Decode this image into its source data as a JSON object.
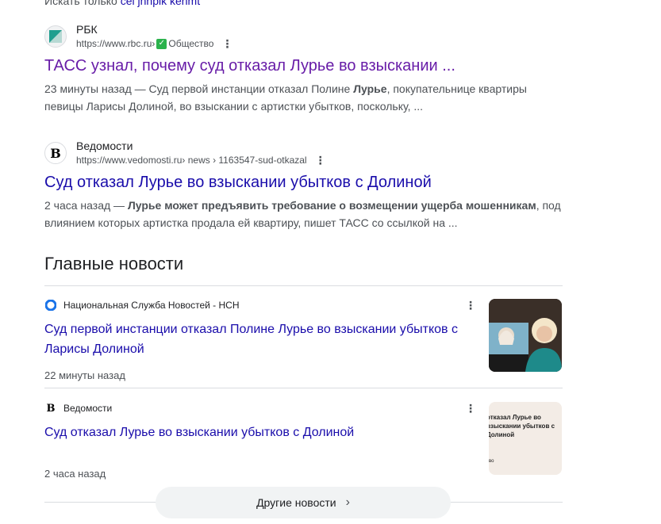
{
  "top": {
    "prefix": "Искать только ",
    "link": "cei jhnpik kehmt"
  },
  "results": [
    {
      "source": "РБК",
      "url": "https://www.rbc.ru",
      "url_sep": " › ",
      "url_tail": "Общество",
      "title": "ТАСС узнал, почему суд отказал Лурье во взыскании ...",
      "snippet_pre": "23 минуты назад — Суд первой инстанции отказал Полине ",
      "snippet_bold": "Лурье",
      "snippet_post": ", покупательнице квартиры певицы Ларисы Долиной, во взыскании с артистки убытков, поскольку, ..."
    },
    {
      "source": "Ведомости",
      "url": "https://www.vedomosti.ru",
      "url_tail": " › news › 1163547-sud-otkazal",
      "title": "Суд отказал Лурье во взыскании убытков с Долиной",
      "snippet_pre": "2 часа назад — ",
      "snippet_bold": "Лурье может предъявить требование о возмещении ущерба мошенникам",
      "snippet_post": ", под влиянием которых артистка продала ей квартиру, пишет ТАСС со ссылкой на ..."
    }
  ],
  "top_news": {
    "heading": "Главные новости",
    "items": [
      {
        "source": "Национальная Служба Новостей - НСН",
        "title": "Суд первой инстанции отказал Полине Лурье во взыскании убытков с Ларисы Долиной",
        "time": "22 минуты назад"
      },
      {
        "source": "Ведомости",
        "title": "Суд отказал Лурье во взыскании убытков с Долиной",
        "time": "2 часа назад",
        "thumb_text": "отказал Лурье во взыскании убытков с Долиной",
        "thumb_foot": "во"
      }
    ],
    "more": "Другие новости"
  },
  "colors": {
    "link": "#1a0dab",
    "visited": "#681da8",
    "snippet": "#4d5156",
    "check": "#2bb24c"
  },
  "icons": {
    "rbc": "rbc-logo-icon",
    "vedomosti": "vedomosti-logo-icon",
    "nsn": "nsn-logo-icon",
    "more": "chevron-right-icon"
  }
}
